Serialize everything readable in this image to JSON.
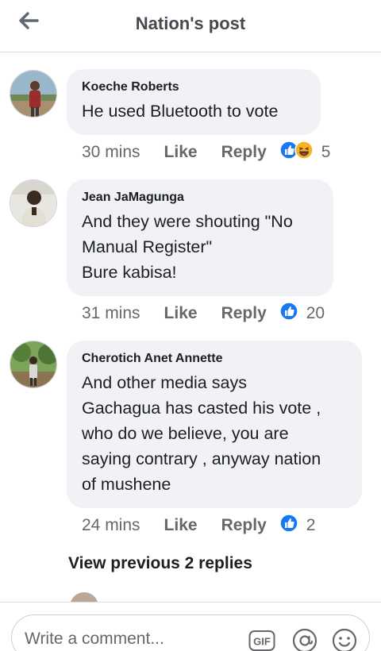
{
  "header": {
    "title": "Nation's post"
  },
  "comments": [
    {
      "author": "Koeche Roberts",
      "text": "He used Bluetooth to vote",
      "time": "30 mins",
      "like_label": "Like",
      "reply_label": "Reply",
      "reaction_count": "5",
      "reactions": [
        "like-icon",
        "haha-icon"
      ]
    },
    {
      "author": "Jean JaMagunga",
      "text": "And they were shouting \"No\nManual Register\"\nBure kabisa!",
      "time": "31 mins",
      "like_label": "Like",
      "reply_label": "Reply",
      "reaction_count": "20",
      "reactions": [
        "like-icon"
      ]
    },
    {
      "author": "Cherotich Anet Annette",
      "text": "And other media says\nGachagua has casted his vote ,\nwho do we believe, you are\nsaying contrary , anyway nation\nof mushene",
      "time": "24 mins",
      "like_label": "Like",
      "reply_label": "Reply",
      "reaction_count": "2",
      "reactions": [
        "like-icon"
      ]
    }
  ],
  "view_previous": "View previous 2 replies",
  "composer": {
    "placeholder": "Write a comment..."
  },
  "colors": {
    "like_blue": "#1877f2",
    "haha_yellow": "#f7b125",
    "text_muted": "#65676b",
    "bubble_bg": "#f0f2f5"
  }
}
